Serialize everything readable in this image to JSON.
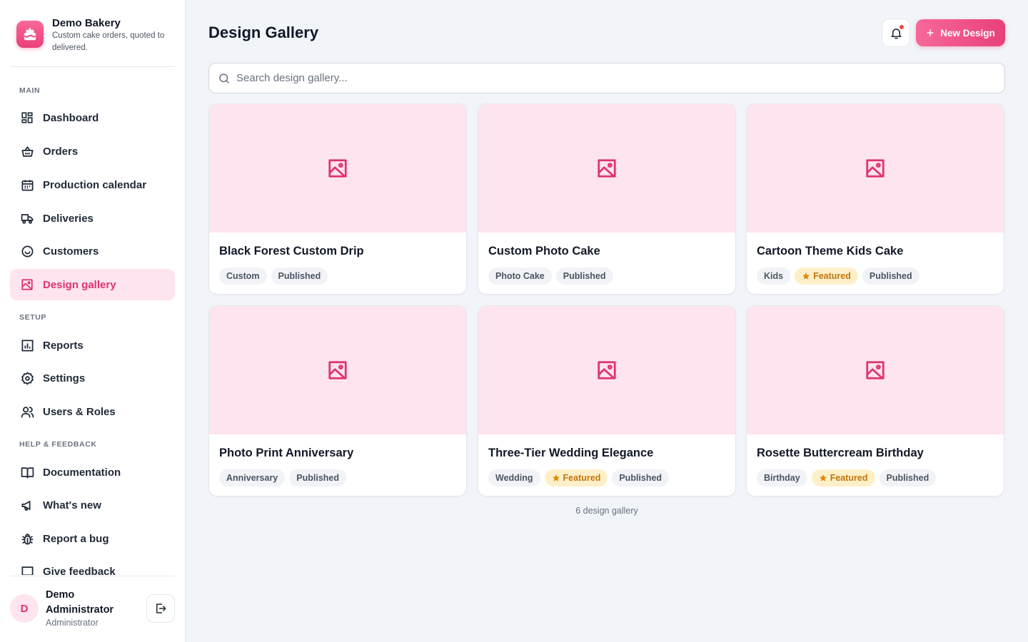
{
  "brand": {
    "name": "Demo Bakery",
    "tagline": "Custom cake orders, quoted to delivered."
  },
  "sidebar": {
    "sections": {
      "main": "MAIN",
      "setup": "SETUP",
      "help": "HELP & FEEDBACK"
    },
    "main_items": [
      {
        "label": "Dashboard",
        "icon": "dashboard-icon"
      },
      {
        "label": "Orders",
        "icon": "basket-icon"
      },
      {
        "label": "Production calendar",
        "icon": "calendar-icon"
      },
      {
        "label": "Deliveries",
        "icon": "truck-icon"
      },
      {
        "label": "Customers",
        "icon": "smile-icon"
      },
      {
        "label": "Design gallery",
        "icon": "image-icon",
        "active": true
      }
    ],
    "setup_items": [
      {
        "label": "Reports",
        "icon": "chart-icon"
      },
      {
        "label": "Settings",
        "icon": "gear-icon"
      },
      {
        "label": "Users & Roles",
        "icon": "users-icon"
      }
    ],
    "help_items": [
      {
        "label": "Documentation",
        "icon": "book-icon"
      },
      {
        "label": "What's new",
        "icon": "megaphone-icon"
      },
      {
        "label": "Report a bug",
        "icon": "bug-icon"
      },
      {
        "label": "Give feedback",
        "icon": "message-icon"
      }
    ]
  },
  "user": {
    "initial": "D",
    "name": "Demo Administrator",
    "role": "Administrator"
  },
  "header": {
    "title": "Design Gallery",
    "new_button": "New Design"
  },
  "search": {
    "placeholder": "Search design gallery...",
    "value": ""
  },
  "designs": [
    {
      "title": "Black Forest Custom Drip",
      "tags": [
        {
          "label": "Custom"
        },
        {
          "label": "Published"
        }
      ]
    },
    {
      "title": "Custom Photo Cake",
      "tags": [
        {
          "label": "Photo Cake"
        },
        {
          "label": "Published"
        }
      ]
    },
    {
      "title": "Cartoon Theme Kids Cake",
      "tags": [
        {
          "label": "Kids"
        },
        {
          "label": "Featured",
          "featured": true
        },
        {
          "label": "Published"
        }
      ]
    },
    {
      "title": "Photo Print Anniversary",
      "tags": [
        {
          "label": "Anniversary"
        },
        {
          "label": "Published"
        }
      ]
    },
    {
      "title": "Three-Tier Wedding Elegance",
      "tags": [
        {
          "label": "Wedding"
        },
        {
          "label": "Featured",
          "featured": true
        },
        {
          "label": "Published"
        }
      ]
    },
    {
      "title": "Rosette Buttercream Birthday",
      "tags": [
        {
          "label": "Birthday"
        },
        {
          "label": "Featured",
          "featured": true
        },
        {
          "label": "Published"
        }
      ]
    }
  ],
  "footer": {
    "count": "6 design gallery"
  },
  "colors": {
    "accent": "#e0336f",
    "accent_soft": "#fde4ee",
    "featured_bg": "#fdf0c9",
    "featured_text": "#c2760c"
  }
}
